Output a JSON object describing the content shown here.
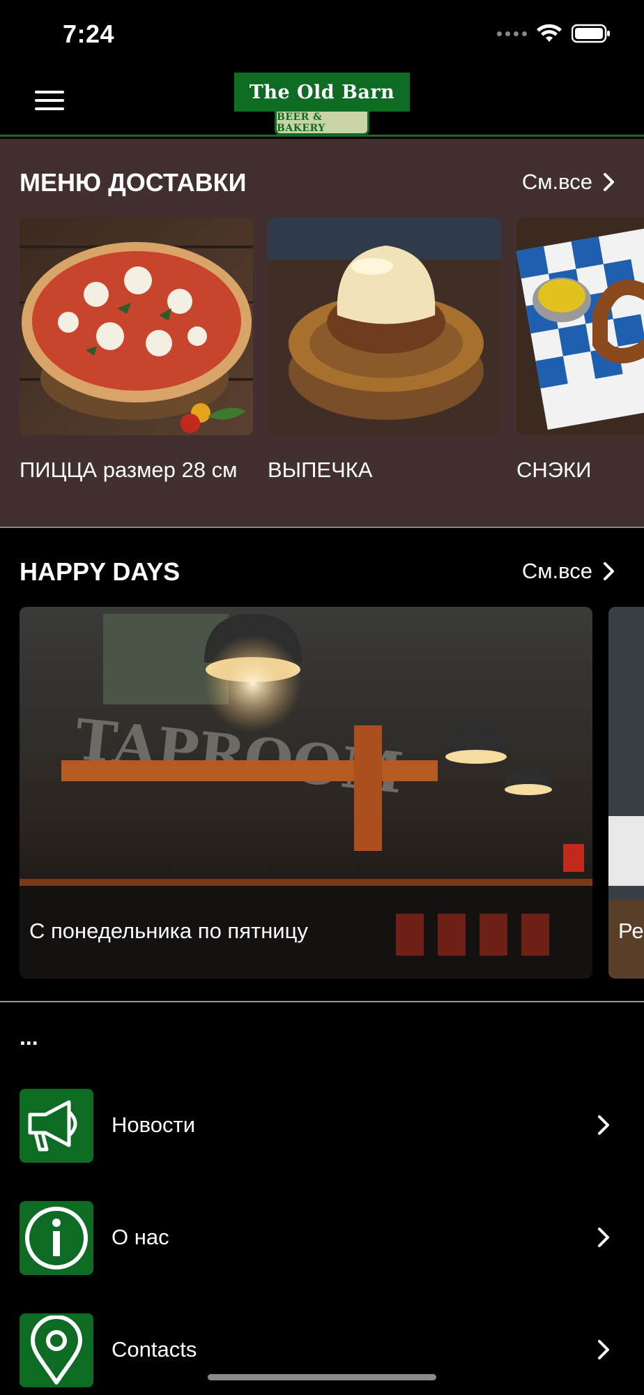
{
  "status_bar": {
    "time": "7:24"
  },
  "header": {
    "logo_main": "The Old Barn",
    "logo_sub": "BEER & BAKERY"
  },
  "delivery": {
    "title": "МЕНЮ ДОСТАВКИ",
    "see_all": "См.все",
    "items": [
      {
        "label": "ПИЦЦА размер 28 см"
      },
      {
        "label": "ВЫПЕЧКА"
      },
      {
        "label": "СНЭКИ"
      }
    ]
  },
  "happy_days": {
    "title": "HAPPY DAYS",
    "see_all": "См.все",
    "events": [
      {
        "caption": "С понедельника по пятницу"
      },
      {
        "caption": "Ре"
      }
    ]
  },
  "more": {
    "title": "...",
    "items": [
      {
        "label": "Новости",
        "icon": "megaphone-icon"
      },
      {
        "label": "О нас",
        "icon": "info-icon"
      },
      {
        "label": "Contacts",
        "icon": "location-pin-icon"
      }
    ]
  },
  "colors": {
    "brand_green": "#0e6b24",
    "section_brown": "#41302f",
    "background": "#000000"
  }
}
